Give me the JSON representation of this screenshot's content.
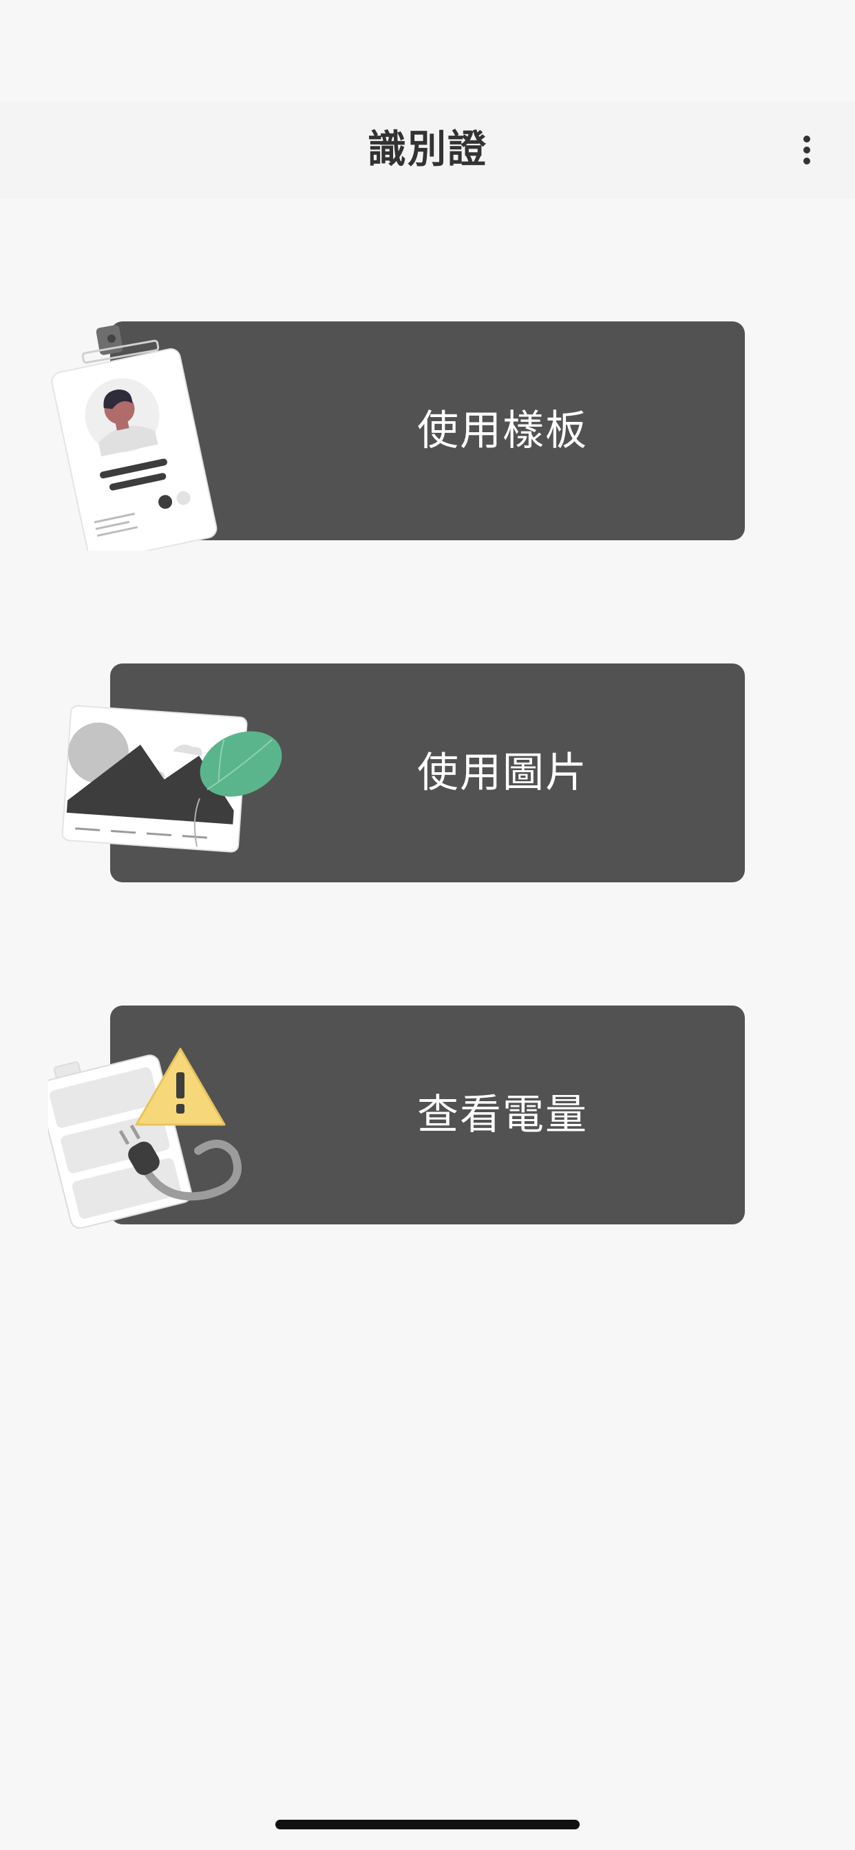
{
  "app_bar": {
    "title": "識別證",
    "more_icon": "more-vert-icon"
  },
  "menu": {
    "items": [
      {
        "label": "使用樣板",
        "icon": "id-badge-illustration"
      },
      {
        "label": "使用圖片",
        "icon": "image-illustration"
      },
      {
        "label": "查看電量",
        "icon": "battery-warning-illustration"
      }
    ]
  },
  "colors": {
    "background": "#f7f7f7",
    "card": "#525252",
    "title": "#333333",
    "leaf_green": "#5bb58c",
    "warning_yellow": "#f6d87a"
  }
}
